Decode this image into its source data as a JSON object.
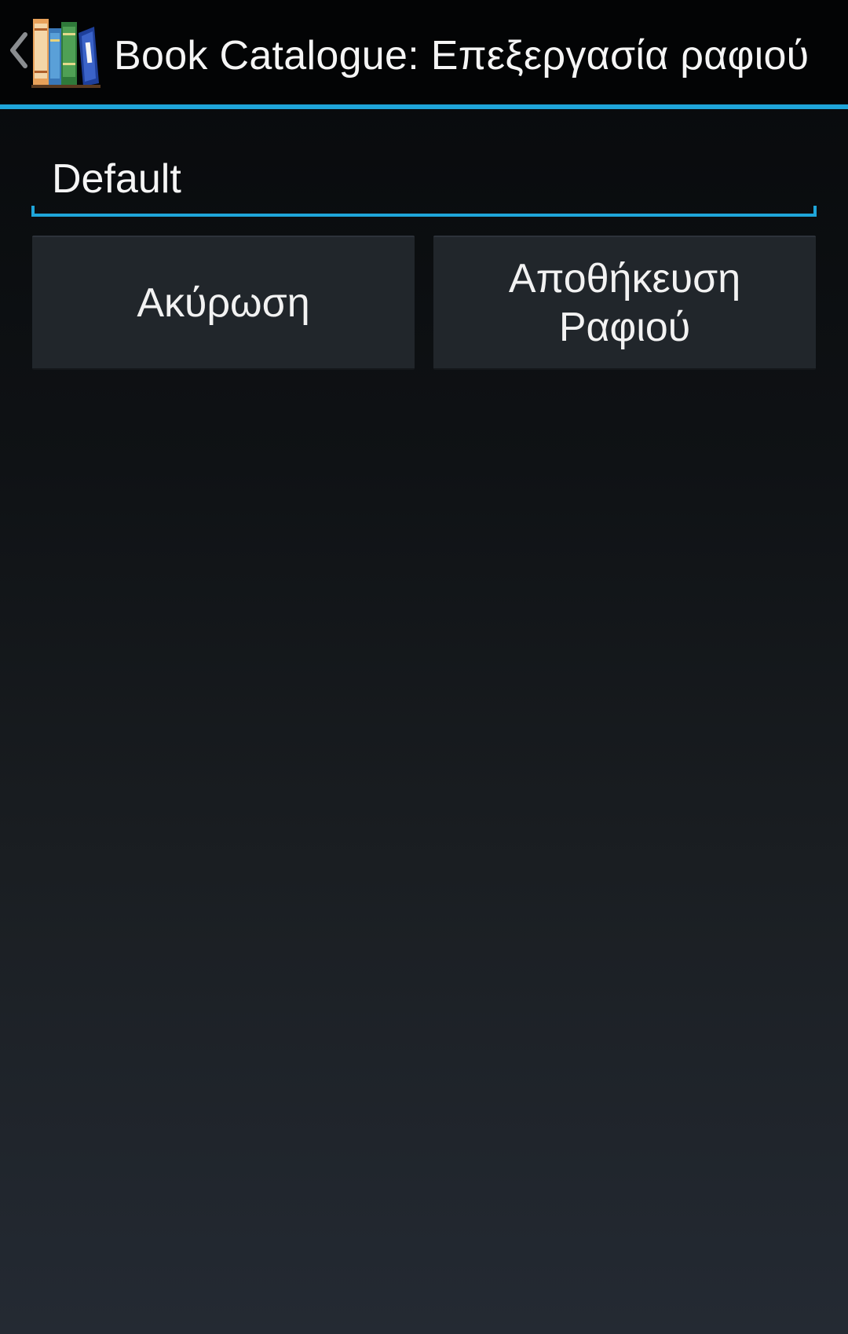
{
  "action_bar": {
    "title": "Book Catalogue: Επεξεργασία ραφιού",
    "up_icon": "chevron-left-icon",
    "app_icon": "books-icon",
    "accent_color": "#1fa5d9"
  },
  "form": {
    "shelf_name_value": "Default"
  },
  "buttons": {
    "cancel_label": "Ακύρωση",
    "save_label": "Αποθήκευση Ραφιού"
  }
}
